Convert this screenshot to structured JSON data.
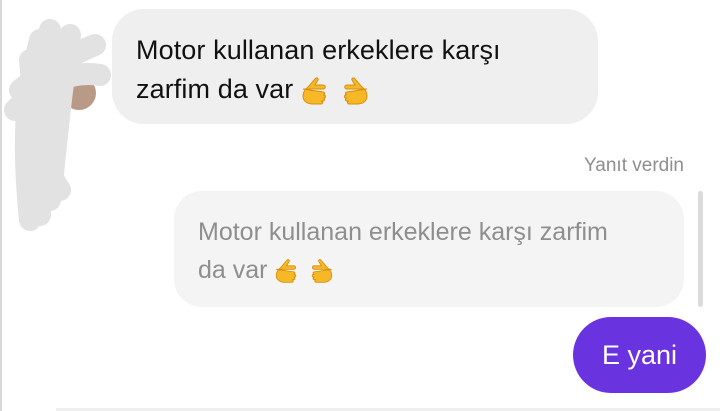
{
  "thread": {
    "incoming": {
      "line1": "Motor kullanan erkeklere karşı",
      "line2": "zarfim da var",
      "emoji_names": [
        "backhand-index-pointing-right",
        "backhand-index-pointing-left"
      ]
    },
    "reply_label": "Yanıt verdin",
    "quoted": {
      "line1": "Motor kullanan erkeklere karşı zarfim",
      "line2": "da var"
    },
    "outgoing": {
      "text": "E yani"
    }
  },
  "colors": {
    "incoming_bubble": "#efefef",
    "quoted_bubble": "#f4f4f4",
    "outgoing_bubble": "#6a33e0",
    "muted_text": "#8e8e8e"
  },
  "icons": {
    "avatar": "avatar-redacted",
    "emoji_pair": "pointing-hands-emoji"
  }
}
